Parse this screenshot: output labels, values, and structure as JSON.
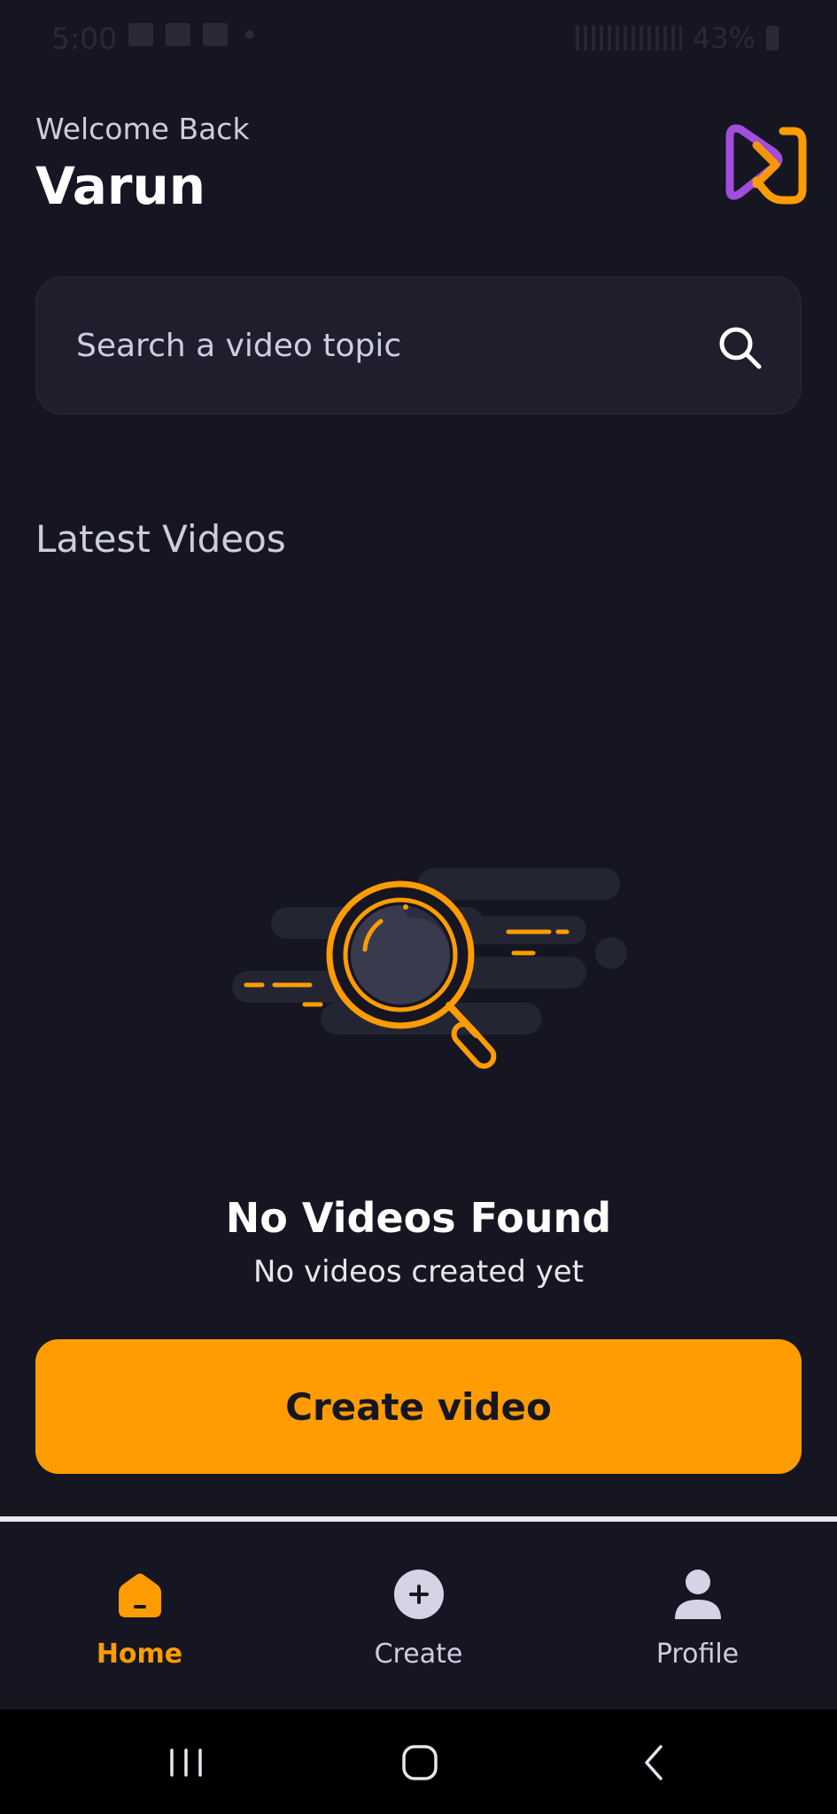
{
  "status_bar": {
    "time": "5:00",
    "battery": "43%"
  },
  "header": {
    "greeting": "Welcome Back",
    "user_name": "Varun"
  },
  "search": {
    "placeholder": "Search a video topic"
  },
  "section_title": "Latest Videos",
  "empty_state": {
    "title": "No Videos Found",
    "subtitle": "No videos created yet"
  },
  "create_button_label": "Create video",
  "tabs": [
    {
      "label": "Home",
      "icon": "home-icon",
      "active": true
    },
    {
      "label": "Create",
      "icon": "plus-circle-icon",
      "active": false
    },
    {
      "label": "Profile",
      "icon": "profile-icon",
      "active": false
    }
  ],
  "colors": {
    "background": "#161622",
    "accent": "#ff9c01",
    "surface": "#1e1e2d",
    "text_muted": "#cdcde0"
  }
}
